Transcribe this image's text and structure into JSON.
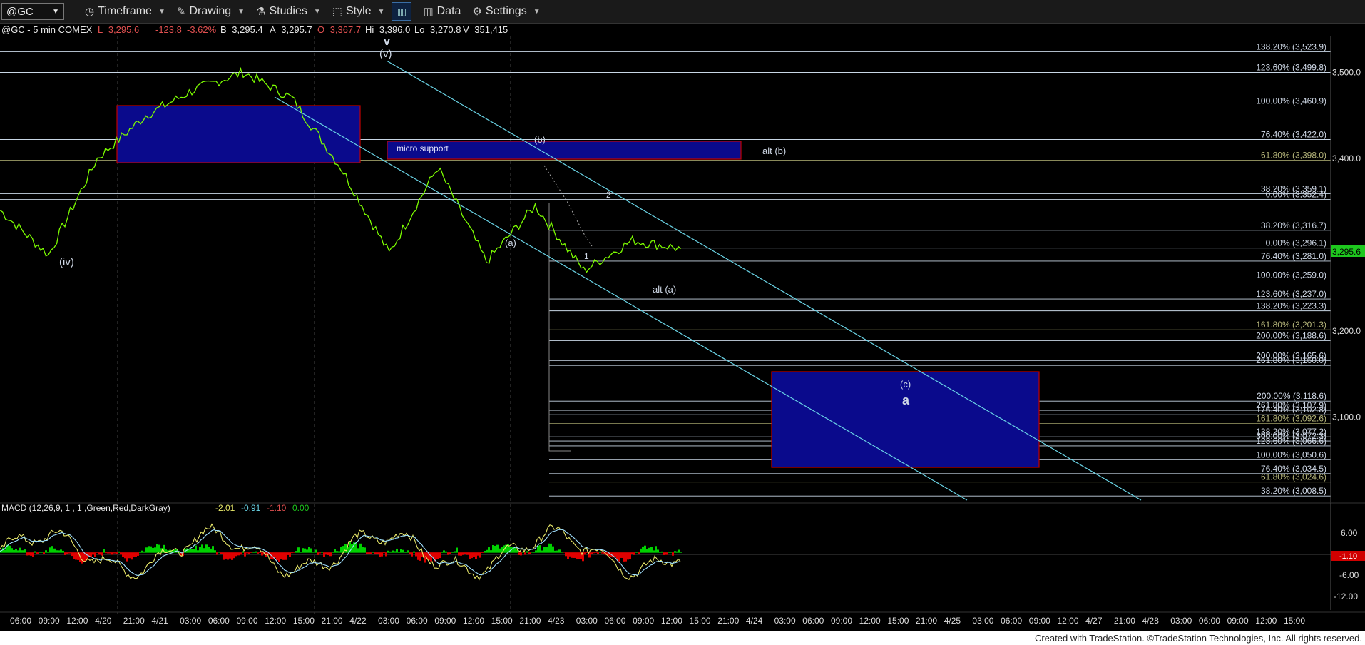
{
  "toolbar": {
    "symbol": "@GC",
    "timeframe": "Timeframe",
    "drawing": "Drawing",
    "studies": "Studies",
    "style": "Style",
    "data": "Data",
    "settings": "Settings"
  },
  "header": {
    "symbol_info": "@GC - 5 min  COMEX",
    "last": "L=3,295.6",
    "change": "-123.8",
    "change_pct": "-3.62%",
    "bid": "B=3,295.4",
    "ask": "A=3,295.7",
    "open": "O=3,367.7",
    "high": "Hi=3,396.0",
    "low": "Lo=3,270.8",
    "volume": "V=351,415"
  },
  "colors": {
    "price": "#7CFC00",
    "ask_price": "#7CFC00",
    "up": "#00d000",
    "down": "#e00000",
    "open": "#e05050",
    "fib_line": "#c8d6e5",
    "box": "#0a0a8c",
    "box_border": "#c00000",
    "channel": "#6ad4e6",
    "macd": "#e8e86a",
    "signal": "#a0e0ff"
  },
  "chart_data": [
    {
      "type": "line",
      "title": "@GC - 5 min  COMEX",
      "price_axis": {
        "ticks": [
          3500.0,
          3400.0,
          3200.0,
          3100.0
        ],
        "tick_labels": [
          "3,500.0",
          "3,400.0",
          "3,200.0",
          "3,100.0"
        ],
        "ylim": [
          3007,
          3530
        ]
      },
      "time_axis": {
        "tick_labels": [
          "06:00",
          "09:00",
          "12:00",
          "4/20",
          "21:00",
          "4/21",
          "03:00",
          "06:00",
          "09:00",
          "12:00",
          "15:00",
          "21:00",
          "4/22",
          "03:00",
          "06:00",
          "09:00",
          "12:00",
          "15:00",
          "21:00",
          "4/23",
          "03:00",
          "06:00",
          "09:00",
          "12:00",
          "15:00",
          "21:00",
          "4/24",
          "03:00",
          "06:00",
          "09:00",
          "12:00",
          "15:00",
          "21:00",
          "4/25",
          "03:00",
          "06:00",
          "09:00",
          "12:00",
          "4/27",
          "21:00",
          "4/28",
          "03:00",
          "06:00",
          "09:00",
          "12:00",
          "15:00"
        ]
      },
      "current_price": "3,295.6",
      "series": [
        {
          "name": "@GC",
          "x": [
            "start",
            "4/19 12:00",
            "4/20 21:00",
            "4/21 15:00",
            "4/22 00:00",
            "4/22 03:00",
            "4/22 09:00",
            "4/22 15:00",
            "4/22 21:00",
            "4/23 00:00",
            "4/23 03:00",
            "4/23 06:00",
            "4/23 09:00",
            "4/23 12:00",
            "4/23 15:00"
          ],
          "values": [
            3340,
            3288,
            3400,
            3450,
            3480,
            3500,
            3470,
            3390,
            3290,
            3390,
            3280,
            3345,
            3270,
            3305,
            3295.6
          ]
        }
      ],
      "fib_levels": [
        {
          "label": "138.20% (3,523.9)",
          "value": 3523.9
        },
        {
          "label": "123.60% (3,499.8)",
          "value": 3499.8
        },
        {
          "label": "100.00% (3,460.9)",
          "value": 3460.9
        },
        {
          "label": "76.40% (3,422.0)",
          "value": 3422.0
        },
        {
          "label": "61.80% (3,398.0)",
          "value": 3398.0
        },
        {
          "label": "38.20% (3,359.1)",
          "value": 3359.1
        },
        {
          "label": "0.00% (3,352.4)",
          "value": 3352.4
        },
        {
          "label": "38.20% (3,316.7)",
          "value": 3316.7
        },
        {
          "label": "0.00% (3,296.1)",
          "value": 3296.1
        },
        {
          "label": "76.40% (3,281.0)",
          "value": 3281.0
        },
        {
          "label": "100.00% (3,259.0)",
          "value": 3259.0
        },
        {
          "label": "123.60% (3,237.0)",
          "value": 3237.0
        },
        {
          "label": "138.20% (3,223.3)",
          "value": 3223.3
        },
        {
          "label": "161.80% (3,201.3)",
          "value": 3201.3
        },
        {
          "label": "200.00% (3,188.6)",
          "value": 3188.6
        },
        {
          "label": "200.00% (3,165.6)",
          "value": 3165.6
        },
        {
          "label": "261.80% (3,160.0)",
          "value": 3160.0
        },
        {
          "label": "200.00% (3,118.6)",
          "value": 3118.6
        },
        {
          "label": "261.80% (3,107.9)",
          "value": 3107.9
        },
        {
          "label": "176.40% (3,102.8)",
          "value": 3102.8
        },
        {
          "label": "161.80% (3,092.6)",
          "value": 3092.6
        },
        {
          "label": "138.20% (3,077.2)",
          "value": 3077.2
        },
        {
          "label": "300.00% (3,072.3)",
          "value": 3072.3
        },
        {
          "label": "123.60% (3,066.6)",
          "value": 3066.6
        },
        {
          "label": "100.00% (3,050.6)",
          "value": 3050.6
        },
        {
          "label": "76.40% (3,034.5)",
          "value": 3034.5
        },
        {
          "label": "61.80% (3,024.6)",
          "value": 3024.6
        },
        {
          "label": "38.20% (3,008.5)",
          "value": 3008.5
        }
      ],
      "annotations": [
        "v",
        "(v)",
        "(iv)",
        "(a)",
        "(b)",
        "1",
        "2",
        "alt (a)",
        "alt (b)",
        "(c)",
        "a",
        "micro support"
      ]
    },
    {
      "type": "area",
      "title": "MACD (12,26,9, 1 , 1 ,Green,Red,DarkGray)",
      "readouts": [
        "-2.01",
        "-0.91",
        "-1.10",
        "0.00"
      ],
      "y_axis": {
        "ticks": [
          6.0,
          -6.0,
          -12.0
        ],
        "tick_labels": [
          "6.00",
          "-6.00",
          "-12.00"
        ],
        "ylim": [
          -14,
          10
        ]
      },
      "current_value": "-1.10"
    }
  ],
  "footer": "Created with TradeStation. ©TradeStation Technologies, Inc. All rights reserved."
}
